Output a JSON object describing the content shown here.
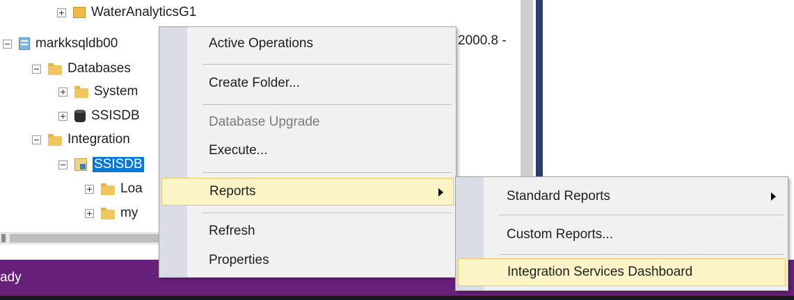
{
  "tree": {
    "nodes": [
      {
        "label": "WaterAnalyticsG1",
        "expander": "plus"
      },
      {
        "label": "markksqldb00",
        "expander": "minus"
      },
      {
        "label": "Databases",
        "expander": "minus"
      },
      {
        "label": "System",
        "expander": "plus"
      },
      {
        "label": "SSISDB",
        "expander": "plus"
      },
      {
        "label": "Integration",
        "expander": "minus"
      },
      {
        "label": "SSISDB",
        "expander": "minus"
      },
      {
        "label": "Loa",
        "expander": "plus"
      },
      {
        "label": "my",
        "expander": "plus"
      }
    ],
    "version_peek": "2000.8 -"
  },
  "context_menu": {
    "items": [
      {
        "label": "Active Operations"
      },
      {
        "label": "Create Folder..."
      },
      {
        "label": "Database Upgrade",
        "disabled": true
      },
      {
        "label": "Execute..."
      },
      {
        "label": "Reports",
        "submenu": true,
        "highlighted": true
      },
      {
        "label": "Refresh"
      },
      {
        "label": "Properties"
      }
    ]
  },
  "reports_submenu": {
    "items": [
      {
        "label": "Standard Reports",
        "submenu": true
      },
      {
        "label": "Custom Reports..."
      },
      {
        "label": "Integration Services Dashboard",
        "highlighted": true
      }
    ]
  },
  "status_bar": {
    "text": "ady",
    "color": "#68217a"
  },
  "colors": {
    "selection": "#0078d7",
    "menu_hover": "#fcf3c6",
    "menu_gutter": "#dadde6"
  }
}
